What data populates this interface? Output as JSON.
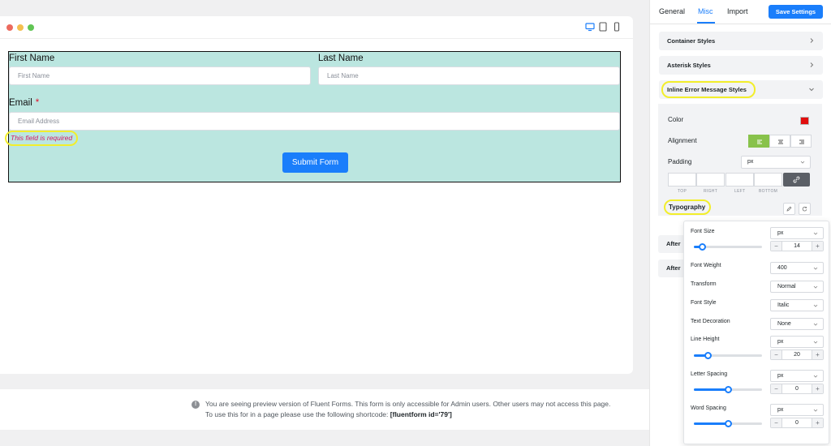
{
  "preview": {
    "form": {
      "first_name_label": "First Name",
      "first_name_placeholder": "First Name",
      "last_name_label": "Last Name",
      "last_name_placeholder": "Last Name",
      "email_label": "Email",
      "required_star": "*",
      "email_placeholder": "Email Address",
      "error_message": "This field is required",
      "submit_label": "Submit Form"
    },
    "notice": {
      "icon": "!",
      "text": "You are seeing preview version of Fluent Forms. This form is only accessible for Admin users. Other users may not access this page. To use this for in a page please use the following shortcode:",
      "shortcode": "[fluentform id='79']"
    }
  },
  "sidebar": {
    "tabs": [
      {
        "label": "General"
      },
      {
        "label": "Misc"
      },
      {
        "label": "Import"
      }
    ],
    "active_tab": "Misc",
    "save_label": "Save Settings",
    "sections": {
      "container_styles": "Container Styles",
      "asterisk_styles": "Asterisk Styles",
      "inline_error": "Inline Error Message Styles",
      "after_1": "After",
      "after_2": "After"
    },
    "inline_error_panel": {
      "color_label": "Color",
      "color_value": "#e10e0e",
      "alignment_label": "Alignment",
      "padding_label": "Padding",
      "padding_unit": "px",
      "padding_sides": [
        "TOP",
        "RIGHT",
        "LEFT",
        "BOTTOM"
      ],
      "typography_label": "Typography"
    }
  },
  "typography": {
    "font_size_label": "Font Size",
    "font_size_unit": "px",
    "font_size_value": "14",
    "font_size_slider": 0.12,
    "font_weight_label": "Font Weight",
    "font_weight_value": "400",
    "transform_label": "Transform",
    "transform_value": "Normal",
    "font_style_label": "Font Style",
    "font_style_value": "Italic",
    "text_decoration_label": "Text Decoration",
    "text_decoration_value": "None",
    "line_height_label": "Line Height",
    "line_height_unit": "px",
    "line_height_value": "20",
    "line_height_slider": 0.2,
    "letter_spacing_label": "Letter Spacing",
    "letter_spacing_unit": "px",
    "letter_spacing_value": "0",
    "letter_spacing_slider": 0.5,
    "word_spacing_label": "Word Spacing",
    "word_spacing_unit": "px",
    "word_spacing_value": "0",
    "word_spacing_slider": 0.5
  },
  "colors": {
    "accent": "#1a7efb",
    "form_background": "#bbe6e0",
    "error_text": "#d51767",
    "highlight": "#f2ee2b",
    "alignment_active": "#88c24b"
  }
}
